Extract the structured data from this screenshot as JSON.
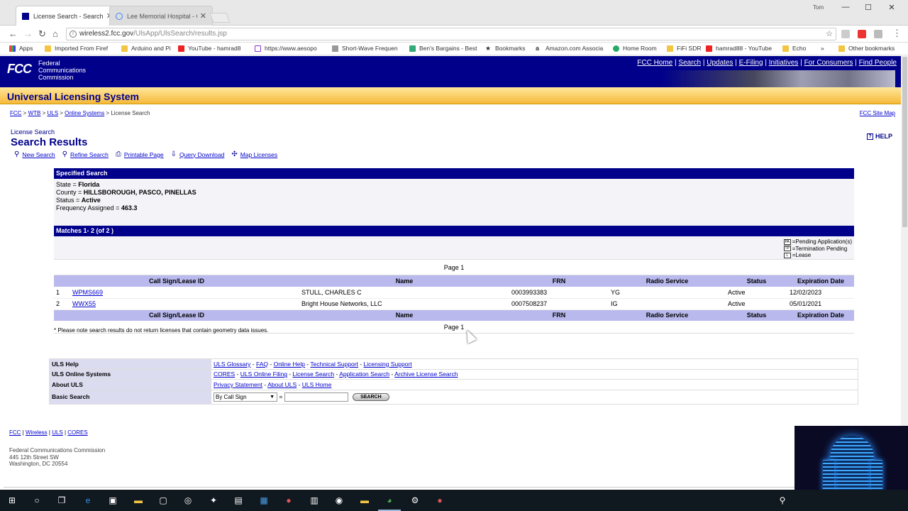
{
  "browser": {
    "tabs": [
      {
        "title": "License Search - Search R",
        "active": true
      },
      {
        "title": "Lee Memorial Hospital - G",
        "active": false
      }
    ],
    "user": "Tom",
    "url_host": "wireless2.fcc.gov",
    "url_path": "/UlsApp/UlsSearch/results.jsp",
    "bookmarks": [
      "Apps",
      "Imported From Firef",
      "Arduino and Pi",
      "YouTube - hamrad8",
      "https://www.aesopo",
      "Short-Wave Frequen",
      "Ben's Bargains - Best",
      "Bookmarks",
      "Amazon.com Associa",
      "Home Room",
      "FiFi SDR",
      "hamrad88 - YouTube",
      "Echo",
      "»",
      "Other bookmarks"
    ]
  },
  "fcc": {
    "logo": "FCC",
    "logo_text": [
      "Federal",
      "Communications",
      "Commission"
    ],
    "nav": [
      "FCC Home",
      "Search",
      "Updates",
      "E-Filing",
      "Initiatives",
      "For Consumers",
      "Find People"
    ],
    "system_title": "Universal Licensing System",
    "breadcrumb": [
      "FCC",
      "WTB",
      "ULS",
      "Online Systems",
      "License Search"
    ],
    "site_map": "FCC Site Map"
  },
  "page": {
    "subtitle": "License Search",
    "title": "Search Results",
    "help": "HELP",
    "tools": [
      "New Search",
      "Refine Search",
      "Printable Page",
      "Query Download",
      "Map Licenses"
    ]
  },
  "specified_search": {
    "header": "Specified Search",
    "criteria": [
      {
        "label": "State",
        "value": "Florida"
      },
      {
        "label": "County",
        "value": "HILLSBOROUGH, PASCO, PINELLAS"
      },
      {
        "label": "Status",
        "value": "Active"
      },
      {
        "label": "Frequency Assigned",
        "value": "463.3"
      }
    ],
    "matches": "Matches 1- 2 (of 2 )"
  },
  "legend": [
    {
      "badge": "PA",
      "label": "Pending Application(s)"
    },
    {
      "badge": "TP",
      "label": "Termination Pending"
    },
    {
      "badge": "L",
      "label": "Lease"
    }
  ],
  "pagination": "Page 1",
  "table": {
    "columns": [
      "Call Sign/Lease ID",
      "Name",
      "FRN",
      "Radio Service",
      "Status",
      "Expiration Date"
    ],
    "rows": [
      {
        "num": "1",
        "call_sign": "WPMS669",
        "name": "STULL, CHARLES C",
        "frn": "0003993383",
        "service": "YG",
        "status": "Active",
        "expiration": "12/02/2023"
      },
      {
        "num": "2",
        "call_sign": "WWX55",
        "name": "Bright House Networks, LLC",
        "frn": "0007508237",
        "service": "IG",
        "status": "Active",
        "expiration": "05/01/2021"
      }
    ]
  },
  "footnote": "* Please note search results do not return licenses that contain geometry data issues.",
  "uls_links": {
    "help_label": "ULS Help",
    "help_links": [
      "ULS Glossary",
      "FAQ",
      "Online Help",
      "Technical Support",
      "Licensing Support"
    ],
    "online_label": "ULS Online Systems",
    "online_links": [
      "CORES",
      "ULS Online Filing",
      "License Search",
      "Application Search",
      "Archive License Search"
    ],
    "about_label": "About ULS",
    "about_links": [
      "Privacy Statement",
      "About ULS",
      "ULS Home"
    ],
    "basic_label": "Basic Search",
    "basic_select": "By Call Sign",
    "basic_eq": "=",
    "basic_button": "SEARCH"
  },
  "footer": {
    "links": [
      "FCC",
      "Wireless",
      "ULS",
      "CORES"
    ],
    "address": [
      "Federal Communications Commission",
      "445 12th Street SW",
      "Washington, DC 20554"
    ]
  }
}
